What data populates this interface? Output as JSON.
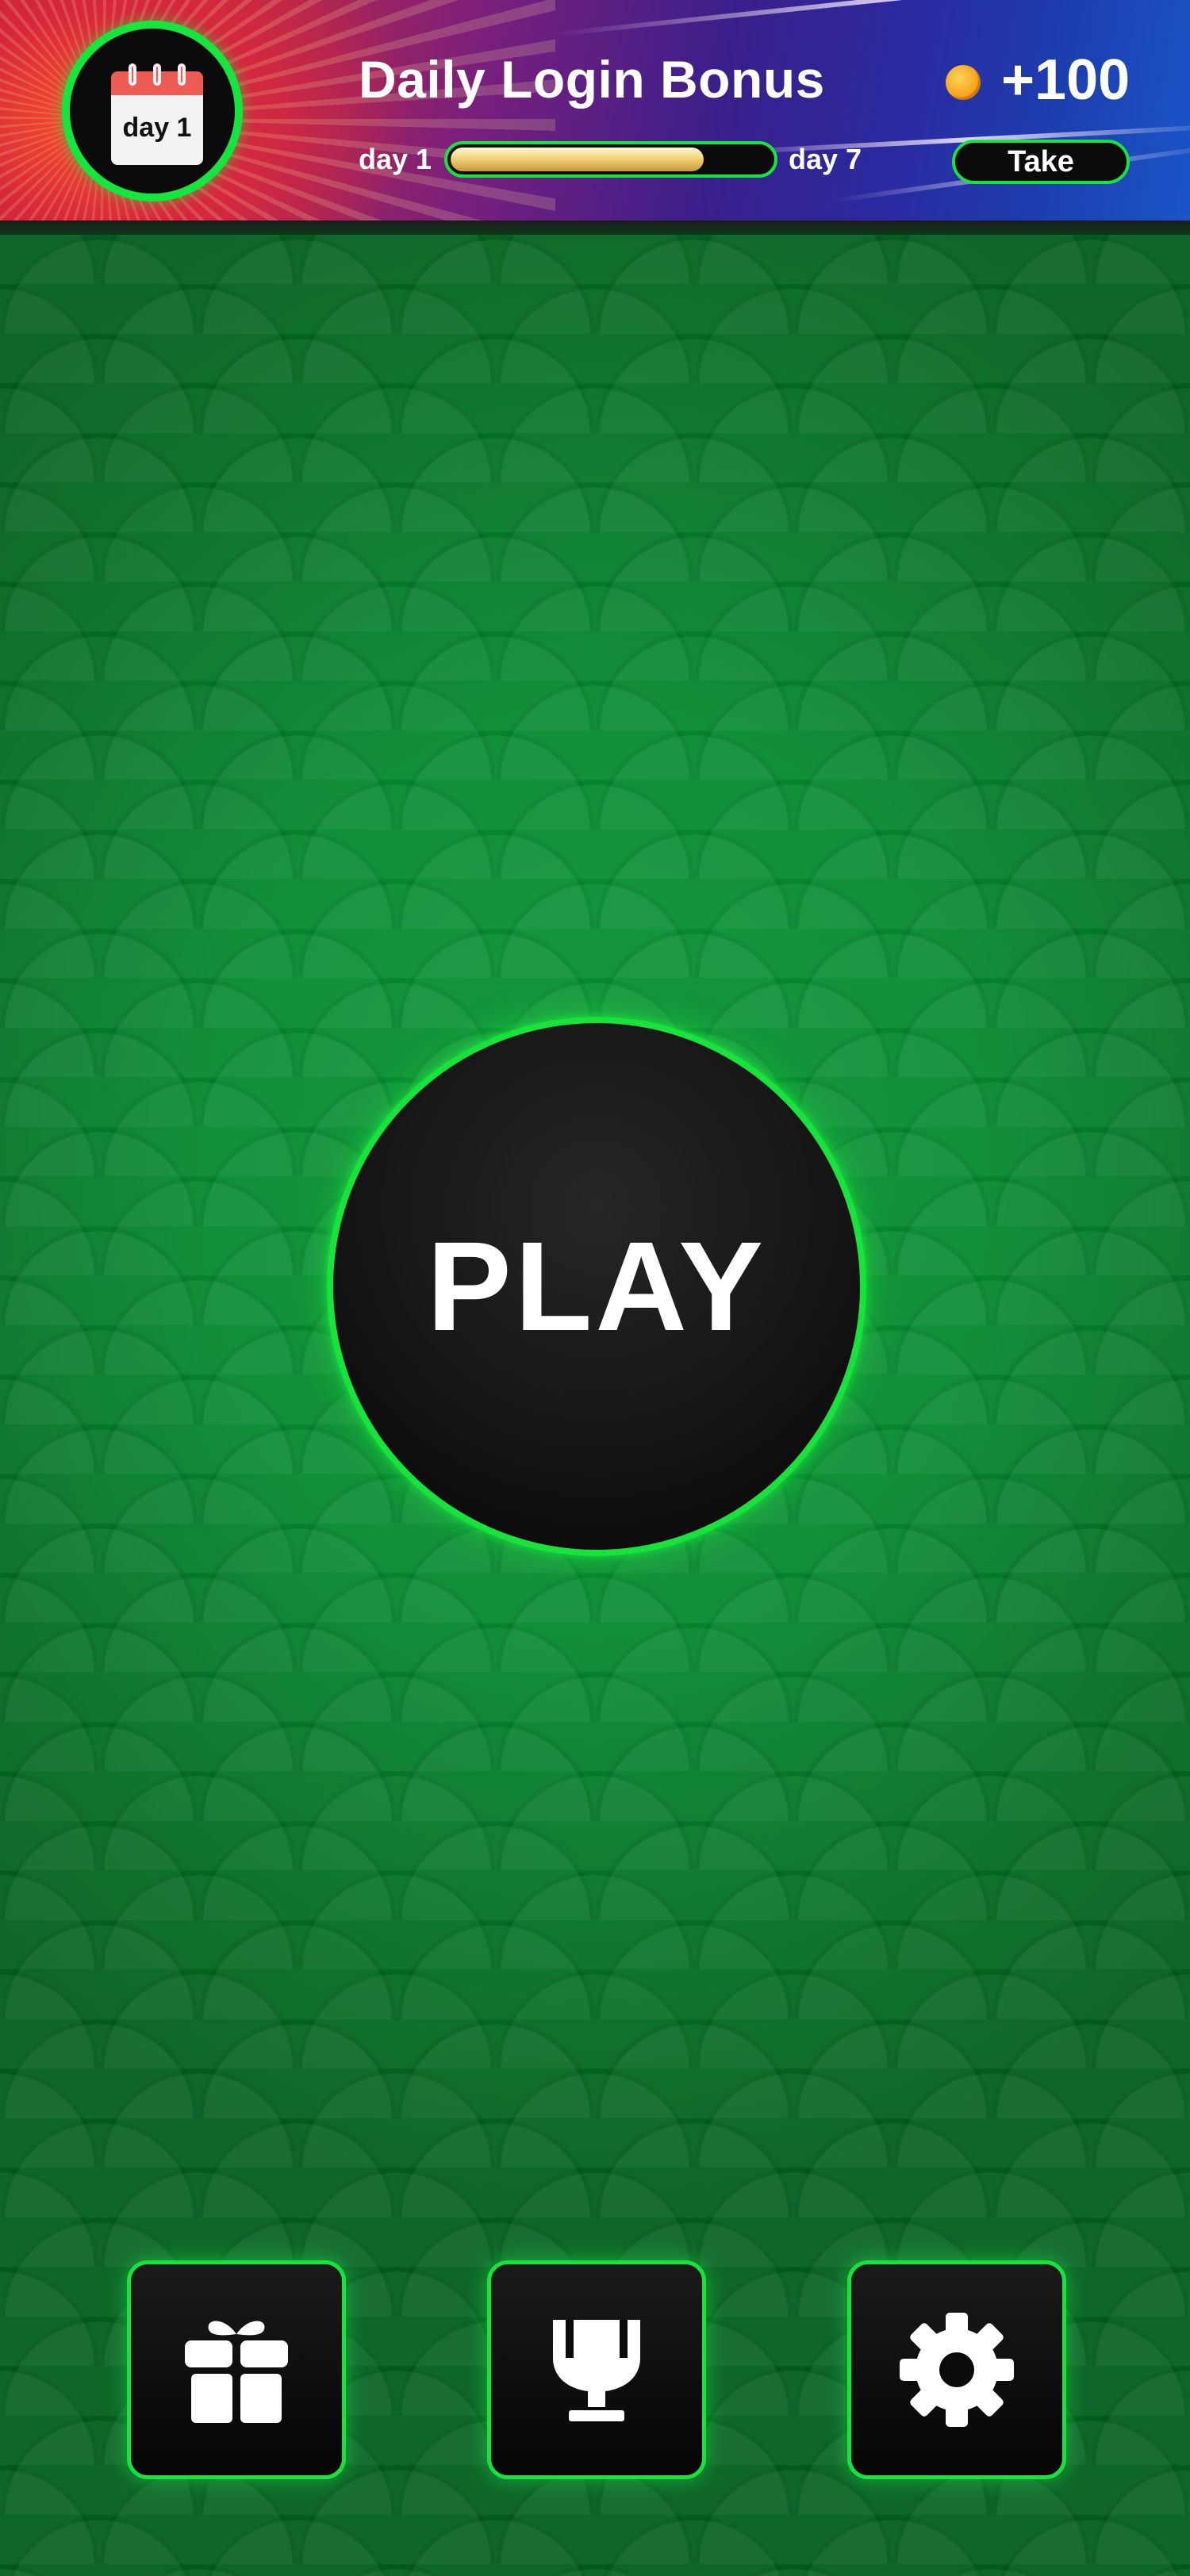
{
  "daily_bonus": {
    "calendar_label": "day 1",
    "title": "Daily Login Bonus",
    "progress": {
      "start_label": "day 1",
      "end_label": "day 7",
      "fraction": 0.79
    },
    "coin_icon": "coin-icon",
    "amount": "+100",
    "take_label": "Take"
  },
  "play": {
    "label": "PLAY"
  },
  "nav": [
    {
      "icon": "gift-icon"
    },
    {
      "icon": "trophy-icon"
    },
    {
      "icon": "gear-icon"
    }
  ],
  "colors": {
    "accent_green": "#18e23c",
    "felt_green": "#07832c",
    "button_black": "#0b0b0b",
    "coin_gold": "#f7a81c"
  }
}
